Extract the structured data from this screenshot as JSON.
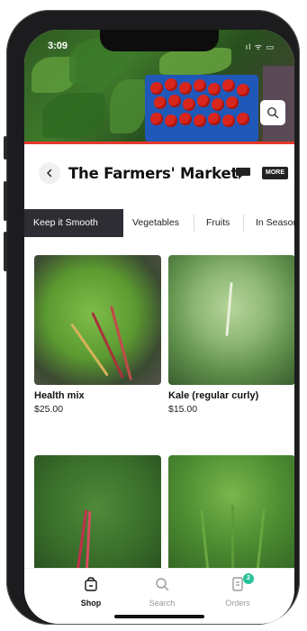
{
  "status_bar": {
    "time": "3:09",
    "icons": "ıl ᯤ ▭"
  },
  "store": {
    "title": "The Farmers' Market",
    "more_label": "MORE"
  },
  "tabs": [
    {
      "label": "Keep it Smooth",
      "active": true
    },
    {
      "label": "Vegetables",
      "active": false
    },
    {
      "label": "Fruits",
      "active": false
    },
    {
      "label": "In Season",
      "active": false
    }
  ],
  "products": [
    {
      "name": "Health mix",
      "price": "$25.00"
    },
    {
      "name": "Kale (regular curly)",
      "price": "$15.00"
    },
    {
      "name": "",
      "price": ""
    },
    {
      "name": "",
      "price": ""
    }
  ],
  "bottom_nav": [
    {
      "label": "Shop",
      "icon": "bag-icon",
      "active": true
    },
    {
      "label": "Search",
      "icon": "search-icon",
      "active": false
    },
    {
      "label": "Orders",
      "icon": "receipt-icon",
      "active": false,
      "badge": "2"
    }
  ],
  "colors": {
    "accent_red": "#e6392d",
    "tab_active_bg": "#2d2d33",
    "badge_green": "#27c39a"
  }
}
